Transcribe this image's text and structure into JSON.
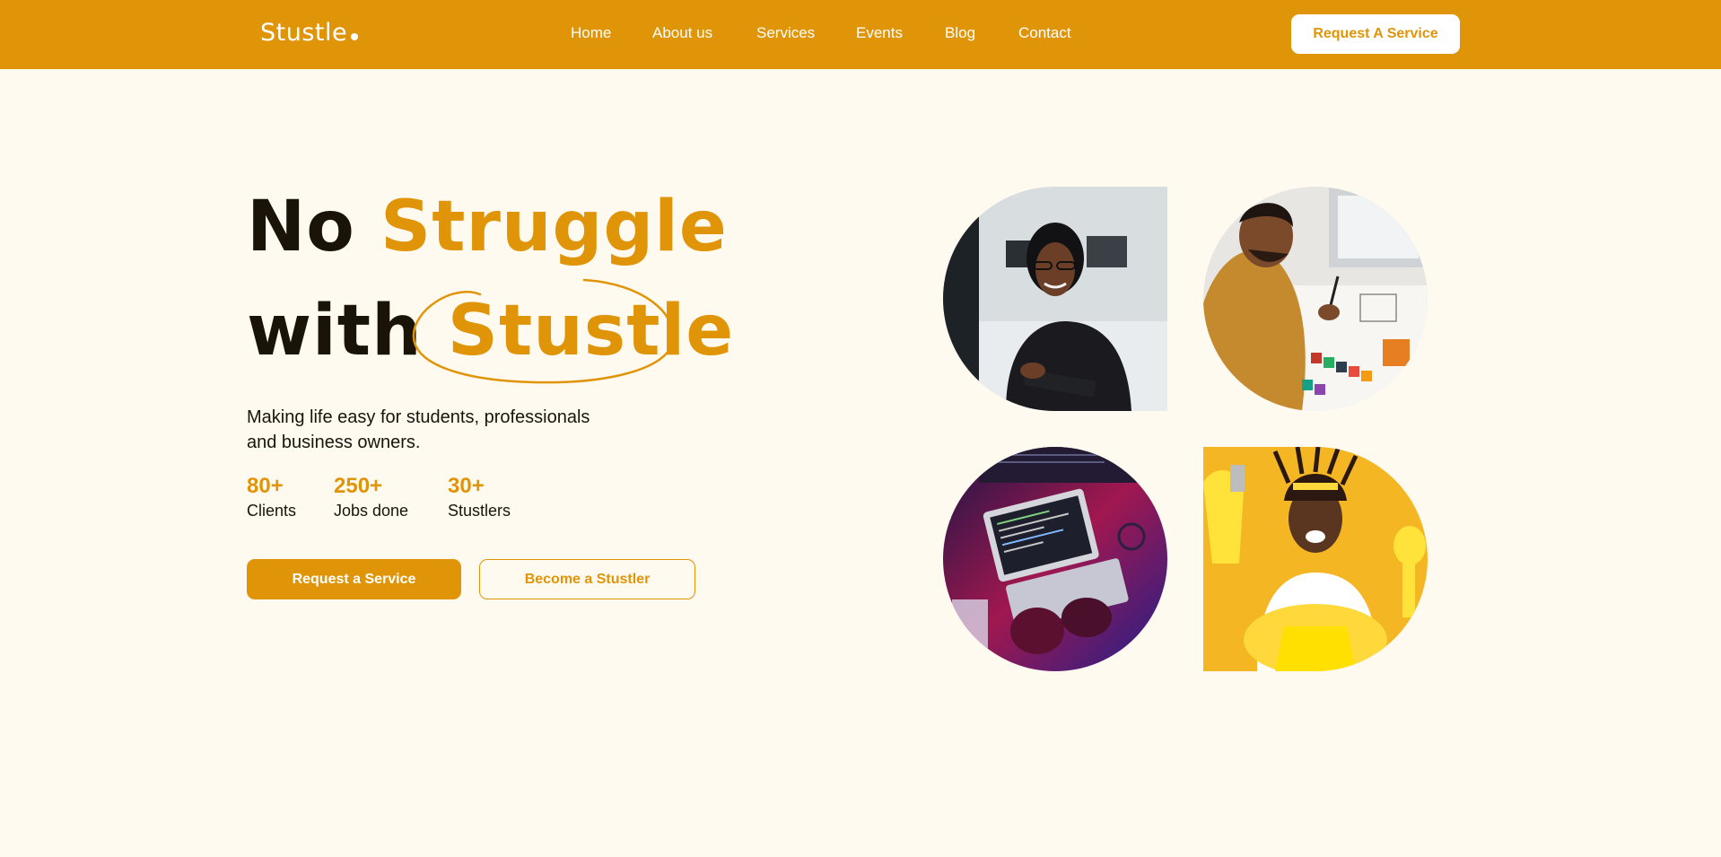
{
  "brand": {
    "name": "Stustle",
    "accent_color": "#e09508",
    "background_color": "#fffaf0"
  },
  "nav": {
    "links": [
      "Home",
      "About us",
      "Services",
      "Events",
      "Blog",
      "Contact"
    ],
    "cta_label": "Request A Service"
  },
  "hero": {
    "title_line1_dark": "No",
    "title_line1_accent": "Struggle",
    "title_line2_dark": "with",
    "title_line2_accent": "Stustle",
    "subtitle_line1": "Making life easy for students, professionals",
    "subtitle_line2": "and business owners.",
    "stats": [
      {
        "value": "80+",
        "label": "Clients"
      },
      {
        "value": "250+",
        "label": "Jobs done"
      },
      {
        "value": "30+",
        "label": "Stustlers"
      }
    ],
    "primary_button": "Request a Service",
    "secondary_button": "Become a Stustler"
  },
  "gallery": {
    "images": [
      {
        "icon": "woman-headset-computer-photo"
      },
      {
        "icon": "man-design-sketching-photo"
      },
      {
        "icon": "laptop-coding-photo"
      },
      {
        "icon": "woman-cleaning-supplies-photo"
      }
    ]
  }
}
